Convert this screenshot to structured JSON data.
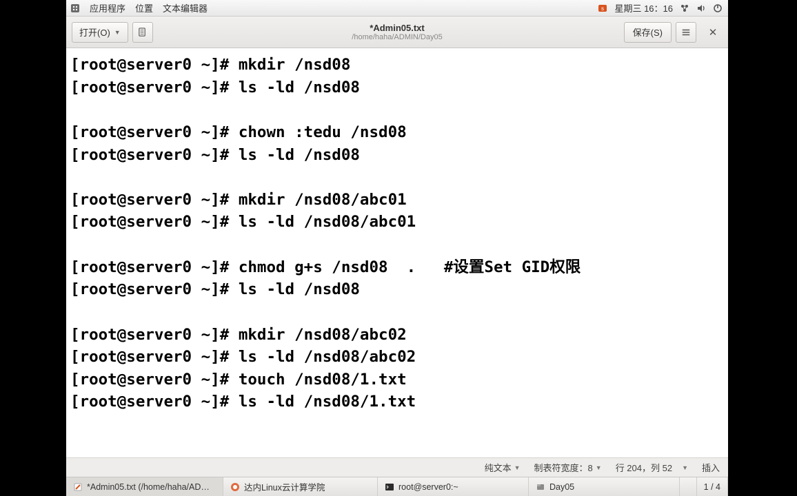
{
  "top_panel": {
    "menus": {
      "apps": "应用程序",
      "places": "位置",
      "editor": "文本编辑器"
    },
    "clock": "星期三 16：16"
  },
  "window": {
    "open_label": "打开(O)",
    "save_label": "保存(S)",
    "title": "*Admin05.txt",
    "path": "/home/haha/ADMIN/Day05",
    "close_glyph": "✕"
  },
  "editor": {
    "lines": [
      "[root@server0 ~]# mkdir /nsd08",
      "[root@server0 ~]# ls -ld /nsd08",
      "",
      "[root@server0 ~]# chown :tedu /nsd08",
      "[root@server0 ~]# ls -ld /nsd08",
      "",
      "[root@server0 ~]# mkdir /nsd08/abc01",
      "[root@server0 ~]# ls -ld /nsd08/abc01",
      "",
      "[root@server0 ~]# chmod g+s /nsd08  .   #设置Set GID权限",
      "[root@server0 ~]# ls -ld /nsd08",
      "",
      "[root@server0 ~]# mkdir /nsd08/abc02",
      "[root@server0 ~]# ls -ld /nsd08/abc02",
      "[root@server0 ~]# touch /nsd08/1.txt",
      "[root@server0 ~]# ls -ld /nsd08/1.txt"
    ]
  },
  "status": {
    "plain_text": "纯文本",
    "tab_width": "制表符宽度：8",
    "position": "行 204，列 52",
    "insert_mode": "插入"
  },
  "taskbar": {
    "items": [
      {
        "label": "*Admin05.txt (/home/haha/AD…",
        "icon": "gedit",
        "active": true
      },
      {
        "label": "达内Linux云计算学院",
        "icon": "browser",
        "active": false
      },
      {
        "label": "root@server0:~",
        "icon": "terminal",
        "active": false
      },
      {
        "label": "Day05",
        "icon": "files",
        "active": false
      }
    ],
    "workspace": "1 / 4"
  }
}
